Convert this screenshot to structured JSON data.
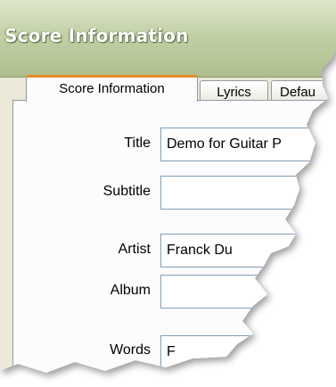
{
  "window": {
    "title": "Score Information"
  },
  "tabs": [
    {
      "label": "Score Information",
      "active": true
    },
    {
      "label": "Lyrics",
      "active": false
    },
    {
      "label": "Defau",
      "active": false
    }
  ],
  "fields": [
    {
      "label": "Title",
      "value": "Demo for Guitar P"
    },
    {
      "label": "Subtitle",
      "value": ""
    },
    {
      "label": "Artist",
      "value": "Franck Du"
    },
    {
      "label": "Album",
      "value": ""
    },
    {
      "label": "Words",
      "value": "F"
    }
  ],
  "colors": {
    "titlebar": "#aebf8e",
    "active_tab_accent": "#e68b2c",
    "field_border": "#7f9db9"
  }
}
